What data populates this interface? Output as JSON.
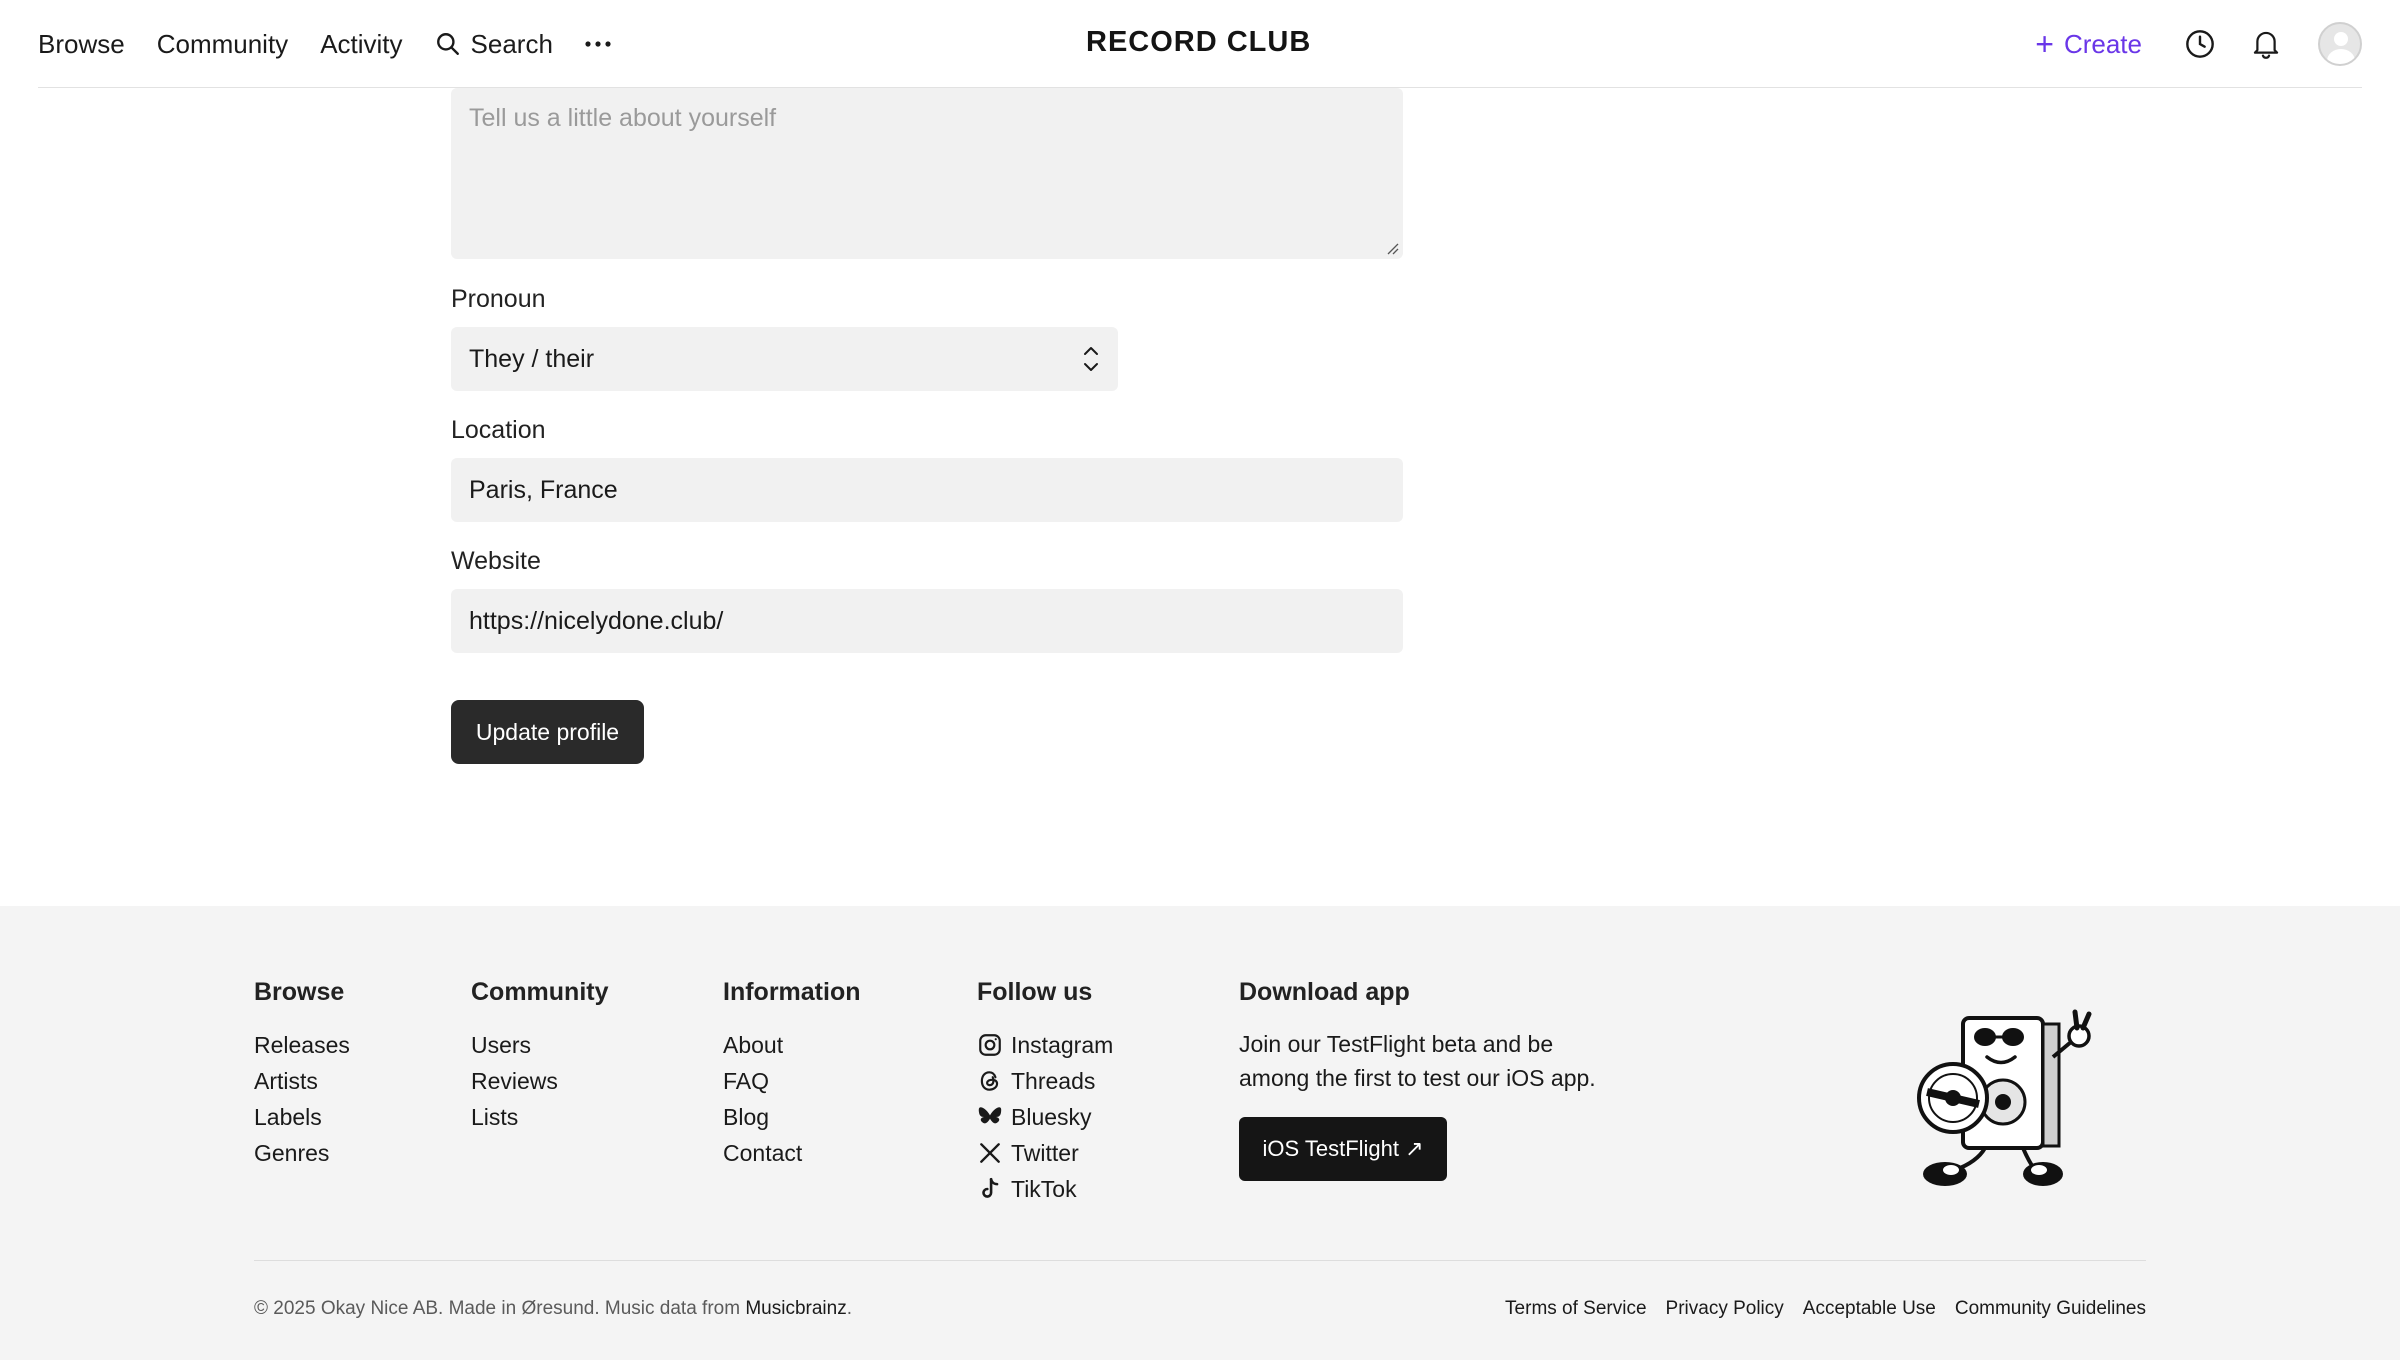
{
  "header": {
    "nav": {
      "browse": "Browse",
      "community": "Community",
      "activity": "Activity",
      "search": "Search"
    },
    "brand": "RECORD CLUB",
    "create": "Create"
  },
  "form": {
    "bio_placeholder": "Tell us a little about yourself",
    "pronoun_label": "Pronoun",
    "pronoun_value": "They / their",
    "location_label": "Location",
    "location_value": "Paris, France",
    "website_label": "Website",
    "website_value": "https://nicelydone.club/",
    "submit": "Update profile"
  },
  "footer": {
    "browse": {
      "title": "Browse",
      "links": [
        "Releases",
        "Artists",
        "Labels",
        "Genres"
      ]
    },
    "community": {
      "title": "Community",
      "links": [
        "Users",
        "Reviews",
        "Lists"
      ]
    },
    "information": {
      "title": "Information",
      "links": [
        "About",
        "FAQ",
        "Blog",
        "Contact"
      ]
    },
    "follow": {
      "title": "Follow us",
      "links": [
        "Instagram",
        "Threads",
        "Bluesky",
        "Twitter",
        "TikTok"
      ]
    },
    "app": {
      "title": "Download app",
      "text": "Join our TestFlight beta and be among the first to test our iOS app.",
      "button": "iOS TestFlight ↗"
    },
    "copyright": "© 2025 Okay Nice AB. Made in Øresund. Music data from",
    "musicbrainz": "Musicbrainz",
    "legal": [
      "Terms of Service",
      "Privacy Policy",
      "Acceptable Use",
      "Community Guidelines"
    ]
  },
  "colors": {
    "accent": "#6a36e8",
    "button_dark": "#2a2a2a",
    "field_bg": "#f1f1f1",
    "footer_bg": "#f4f4f4"
  },
  "icons": [
    "search-icon",
    "more-icon",
    "plus-icon",
    "history-icon",
    "bell-icon",
    "avatar",
    "chevron-updown-icon",
    "instagram-icon",
    "threads-icon",
    "bluesky-icon",
    "twitter-icon",
    "tiktok-icon",
    "mascot-illustration"
  ]
}
